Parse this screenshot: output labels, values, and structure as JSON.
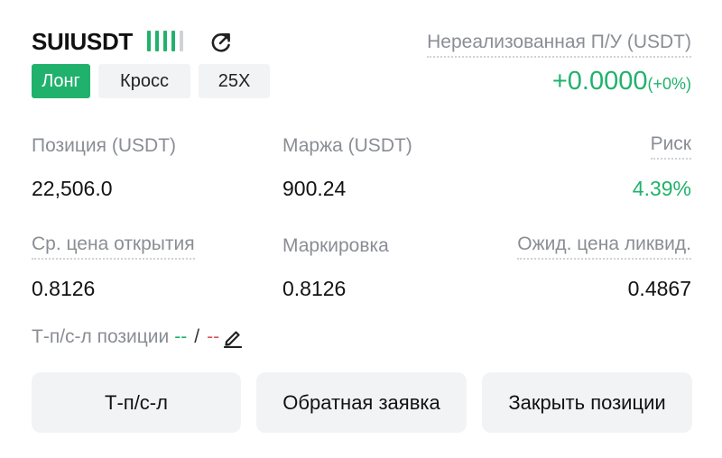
{
  "position": {
    "symbol": "SUIUSDT",
    "signal_icon": "signal-bars-icon",
    "signal_level": 0.8,
    "share_icon": "share-icon",
    "side": "Лонг",
    "margin_mode": "Кросс",
    "leverage": "25X"
  },
  "pnl": {
    "label": "Нереализованная П/У (USDT)",
    "value": "+0.0000",
    "percent": "(+0%)"
  },
  "stats": {
    "position_label": "Позиция (USDT)",
    "position_value": "22,506.0",
    "margin_label": "Маржа (USDT)",
    "margin_value": "900.24",
    "risk_label": "Риск",
    "risk_value": "4.39%",
    "entry_label": "Ср. цена открытия",
    "entry_value": "0.8126",
    "mark_label": "Маркировка",
    "mark_value": "0.8126",
    "liq_label": "Ожид. цена ликвид.",
    "liq_value": "0.4867"
  },
  "tpsl": {
    "label": "Т-п/с-л позиции",
    "tp_value": "--",
    "separator": "/",
    "sl_value": "--",
    "edit_icon": "pencil-icon"
  },
  "actions": {
    "tpsl_label": "Т-п/с-л",
    "reverse_label": "Обратная заявка",
    "close_label": "Закрыть позиции"
  },
  "colors": {
    "accent_green": "#20b26c",
    "loss_red": "#e0525f",
    "muted_text": "#8a8e94",
    "button_bg": "#f2f3f5"
  }
}
